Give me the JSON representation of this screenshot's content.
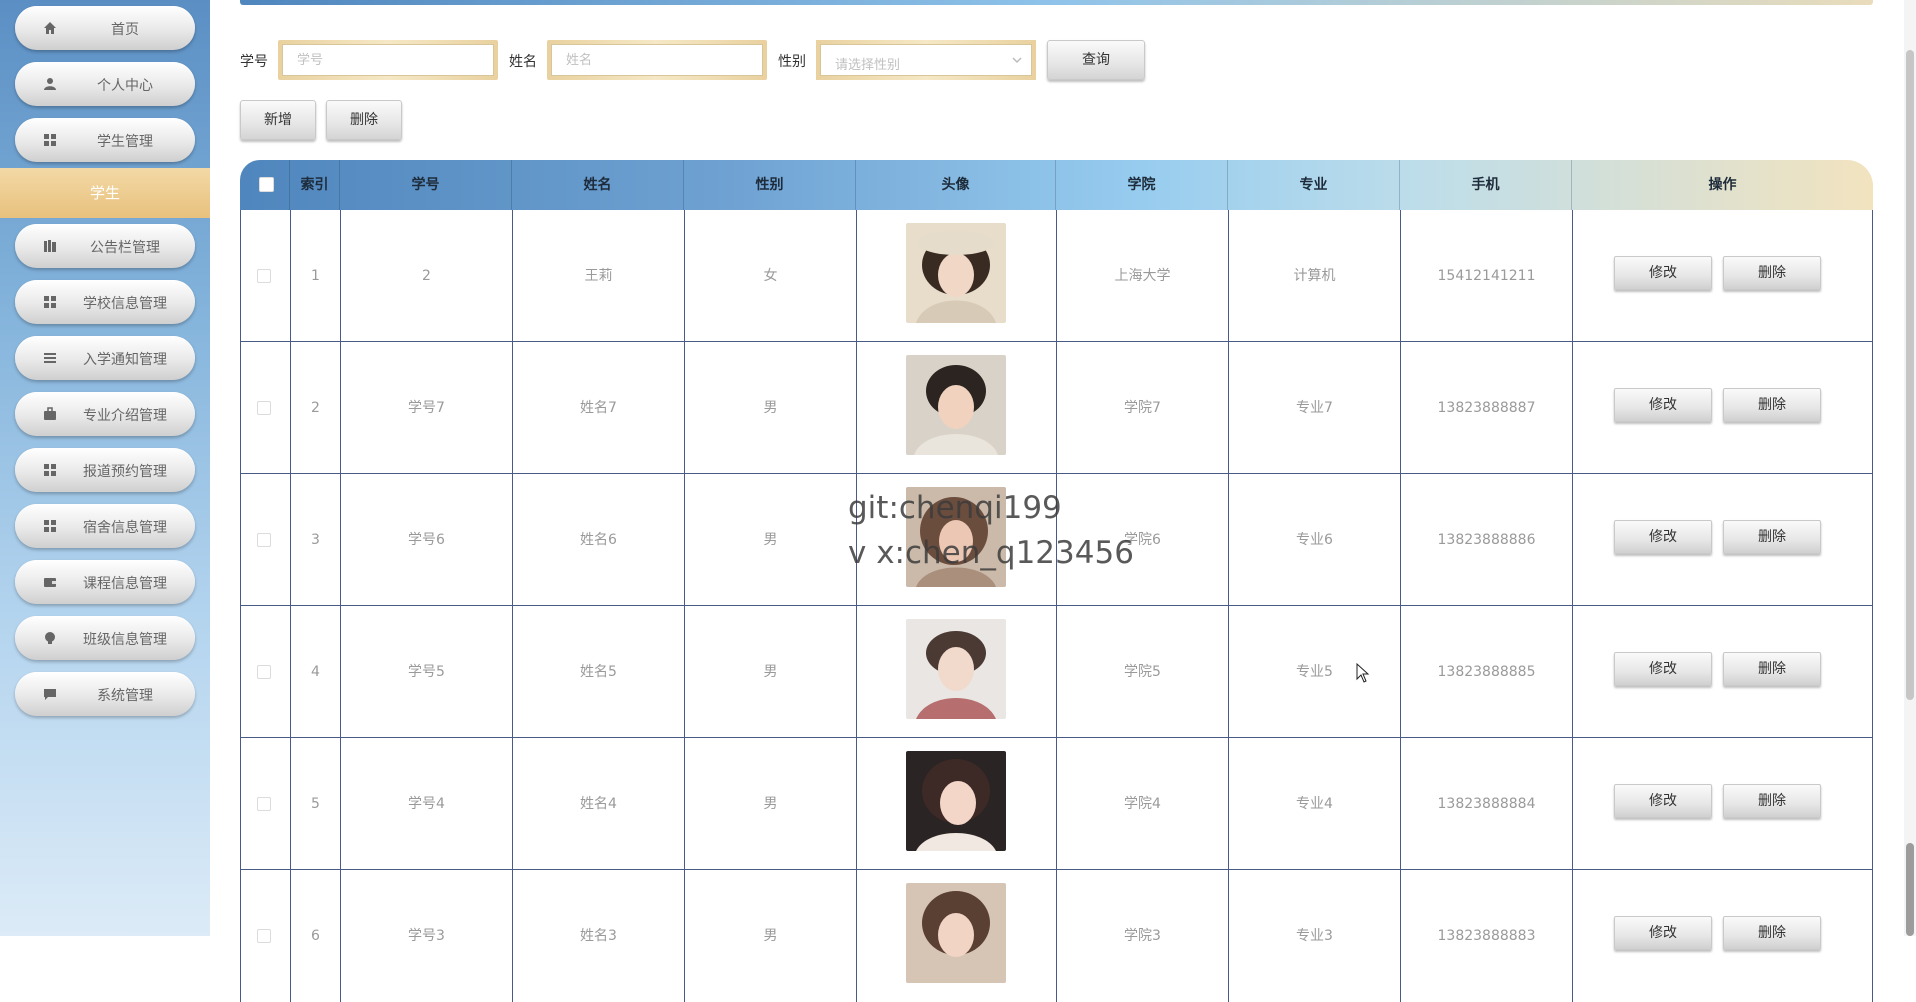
{
  "sidebar": {
    "items": [
      {
        "label": "首页",
        "icon": "home-icon"
      },
      {
        "label": "个人中心",
        "icon": "user-icon"
      },
      {
        "label": "学生管理",
        "icon": "grid-icon"
      },
      {
        "label": "公告栏管理",
        "icon": "book-icon"
      },
      {
        "label": "学校信息管理",
        "icon": "grid-icon"
      },
      {
        "label": "入学通知管理",
        "icon": "list-icon"
      },
      {
        "label": "专业介绍管理",
        "icon": "briefcase-icon"
      },
      {
        "label": "报道预约管理",
        "icon": "grid-icon"
      },
      {
        "label": "宿舍信息管理",
        "icon": "grid-icon"
      },
      {
        "label": "课程信息管理",
        "icon": "wallet-icon"
      },
      {
        "label": "班级信息管理",
        "icon": "bulb-icon"
      },
      {
        "label": "系统管理",
        "icon": "chat-icon"
      }
    ],
    "active_label": "学生"
  },
  "search": {
    "student_no_label": "学号",
    "student_no_placeholder": "学号",
    "name_label": "姓名",
    "name_placeholder": "姓名",
    "gender_label": "性别",
    "gender_placeholder": "请选择性别",
    "query_button": "查询"
  },
  "actions": {
    "add_button": "新增",
    "delete_button": "删除"
  },
  "table": {
    "columns": [
      "索引",
      "学号",
      "姓名",
      "性别",
      "头像",
      "学院",
      "专业",
      "手机",
      "操作"
    ],
    "edit_label": "修改",
    "delete_label": "删除",
    "rows": [
      {
        "index": "1",
        "student_no": "2",
        "name": "王莉",
        "gender": "女",
        "college": "上海大学",
        "major": "计算机",
        "phone": "15412141211"
      },
      {
        "index": "2",
        "student_no": "学号7",
        "name": "姓名7",
        "gender": "男",
        "college": "学院7",
        "major": "专业7",
        "phone": "13823888887"
      },
      {
        "index": "3",
        "student_no": "学号6",
        "name": "姓名6",
        "gender": "男",
        "college": "学院6",
        "major": "专业6",
        "phone": "13823888886"
      },
      {
        "index": "4",
        "student_no": "学号5",
        "name": "姓名5",
        "gender": "男",
        "college": "学院5",
        "major": "专业5",
        "phone": "13823888885"
      },
      {
        "index": "5",
        "student_no": "学号4",
        "name": "姓名4",
        "gender": "男",
        "college": "学院4",
        "major": "专业4",
        "phone": "13823888884"
      },
      {
        "index": "6",
        "student_no": "学号3",
        "name": "姓名3",
        "gender": "男",
        "college": "学院3",
        "major": "专业3",
        "phone": "13823888883"
      }
    ]
  },
  "watermark": "git:chenqi199\nv x:chen_q123456",
  "colors": {
    "sidebar_top": "#5b8fc4",
    "active_gold": "#e8c17d",
    "header_blue": "#4f86bd",
    "header_gold": "#f2e3bf",
    "grid_line": "#4a5a86"
  }
}
